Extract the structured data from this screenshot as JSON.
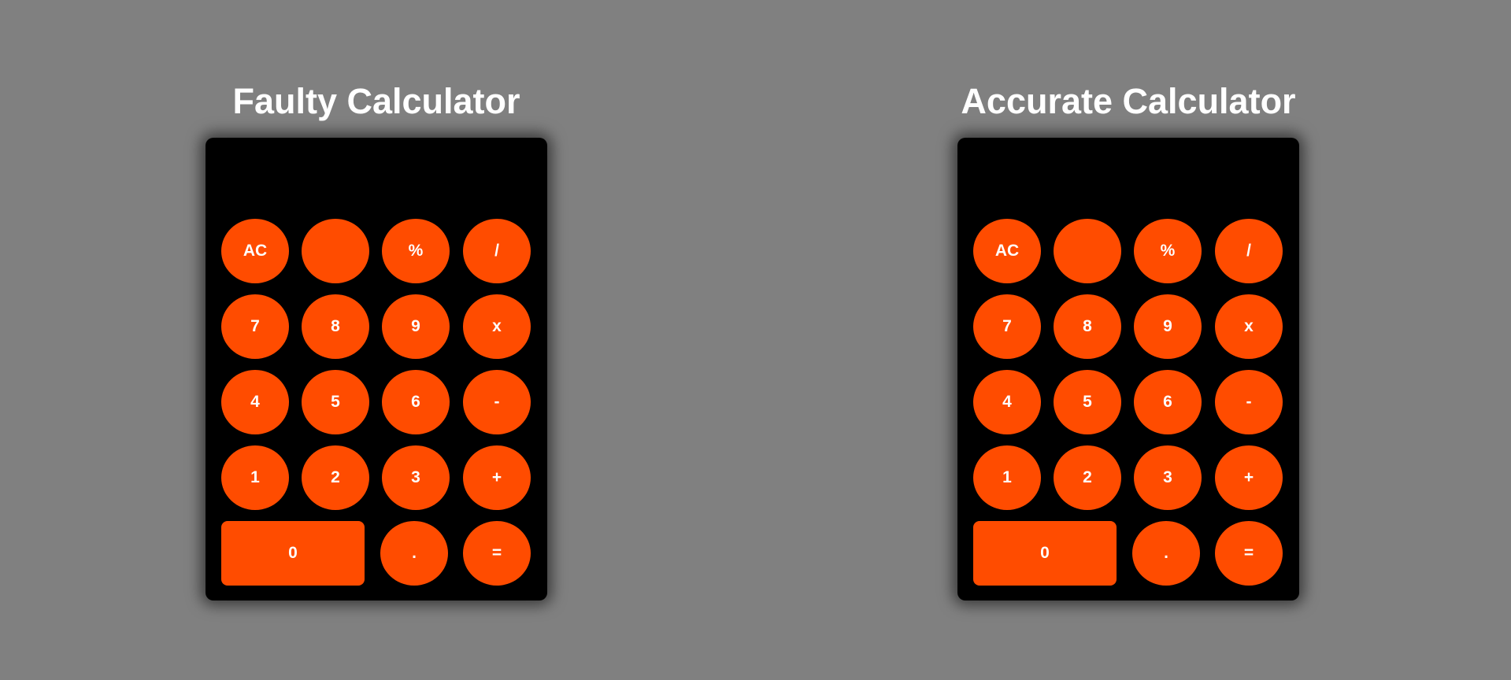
{
  "calculators": [
    {
      "title": "Faulty Calculator",
      "display": "",
      "keys": [
        "AC",
        "",
        "%",
        "/",
        "7",
        "8",
        "9",
        "x",
        "4",
        "5",
        "6",
        "-",
        "1",
        "2",
        "3",
        "+",
        "0",
        ".",
        "="
      ]
    },
    {
      "title": "Accurate Calculator",
      "display": "",
      "keys": [
        "AC",
        "",
        "%",
        "/",
        "7",
        "8",
        "9",
        "x",
        "4",
        "5",
        "6",
        "-",
        "1",
        "2",
        "3",
        "+",
        "0",
        ".",
        "="
      ]
    }
  ],
  "colors": {
    "background": "#808080",
    "calculator_body": "#000000",
    "key": "#ff4c00",
    "key_text": "#ffffff",
    "title": "#ffffff"
  }
}
